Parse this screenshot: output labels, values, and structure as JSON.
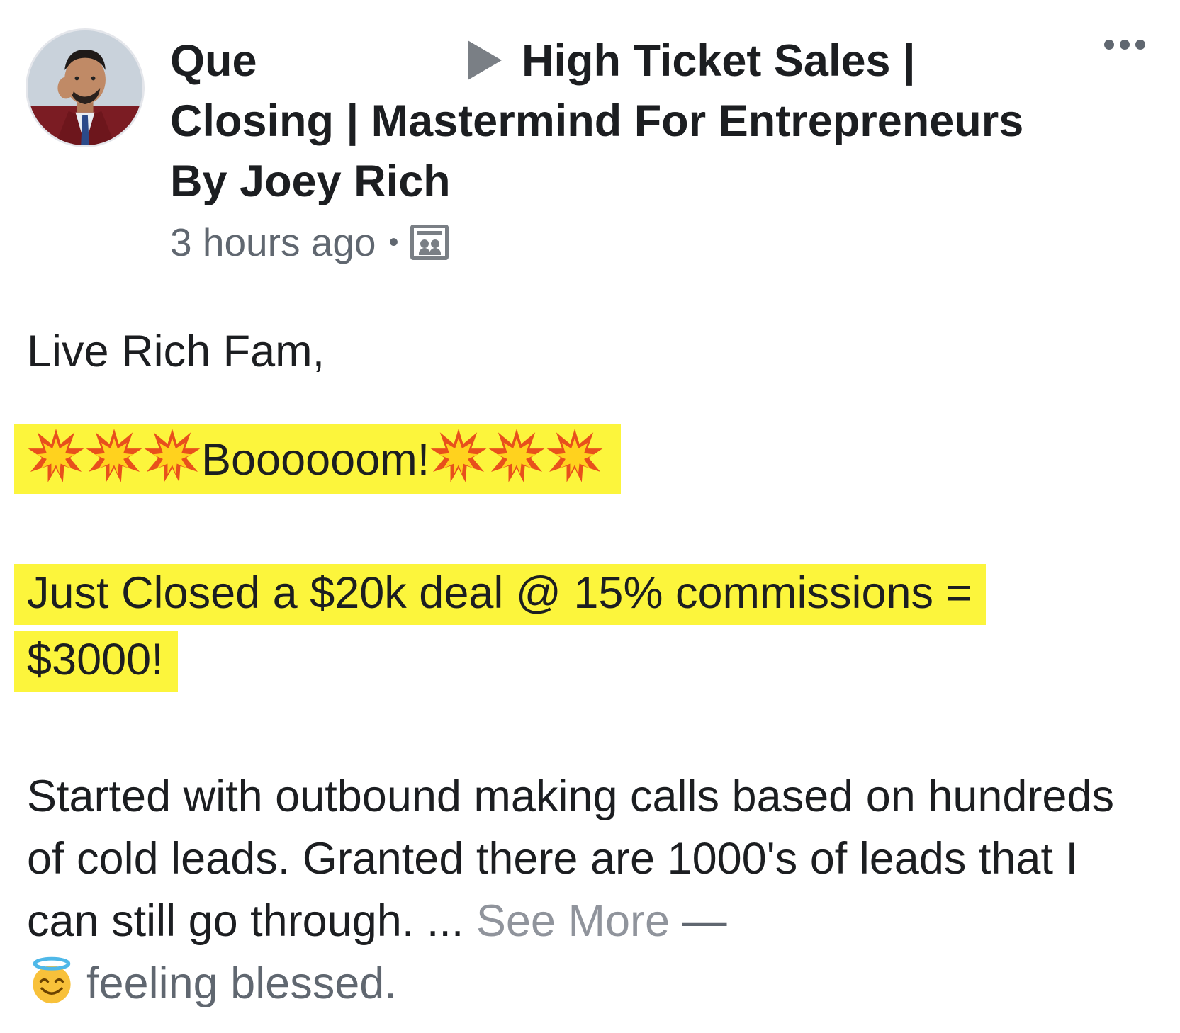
{
  "post": {
    "author": "Que",
    "group": "High Ticket Sales | Closing | Mastermind For Entrepreneurs By Joey Rich",
    "timestamp": "3 hours ago",
    "separator": "•",
    "privacy_icon": "group-members-icon",
    "more_icon": "more-options-icon"
  },
  "body": {
    "greeting": "Live Rich Fam,",
    "boom_text": "Boooooom!",
    "boom_emoji": "collision-icon",
    "deal_text": "Just Closed a $20k deal @ 15% commissions = $3000!",
    "story_text": "Started with outbound making calls based on hundreds of cold leads. Granted there are 1000's of leads that I can still go through. ...",
    "see_more": "See More",
    "dash": "—",
    "feeling_emoji": "smiling-face-with-halo-icon",
    "feeling_text": "feeling blessed."
  },
  "colors": {
    "highlight": "#fcf53c",
    "text": "#1c1e21",
    "secondary_text": "#606770",
    "see_more": "#90949c"
  }
}
